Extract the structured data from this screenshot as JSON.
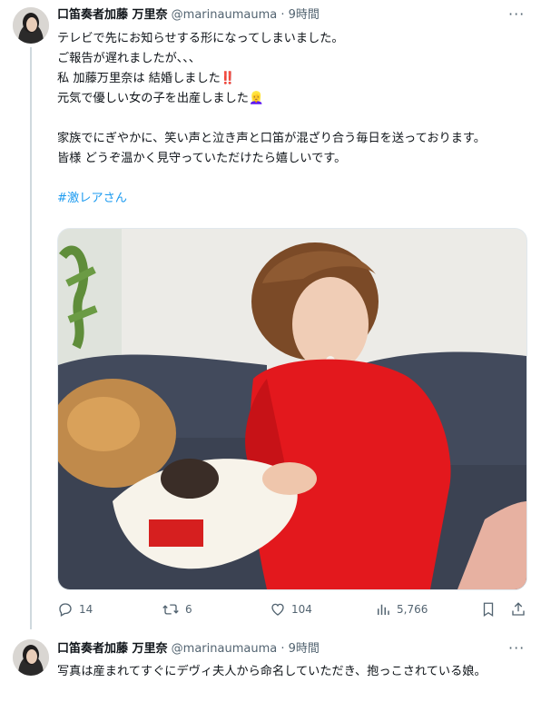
{
  "tweet1": {
    "display_name": "口笛奏者加藤 万里奈",
    "handle": "@marinaumauma",
    "separator": "·",
    "time": "9時間",
    "more": "···",
    "lines": [
      "テレビで先にお知らせする形になってしまいました。",
      "ご報告が遅れましたが、、、",
      "私 加藤万里奈は 結婚しました‼️",
      "元気で優しい女の子を出産しました👱‍♀️",
      "",
      "家族でにぎやかに、笑い声と泣き声と口笛が混ざり合う毎日を送っております。",
      "皆様 どうぞ温かく見守っていただけたら嬉しいです。",
      ""
    ],
    "hashtag": "#激レアさん",
    "media_alt": "赤いワンピースの女性がソファで赤ちゃんを抱いている写真",
    "actions": {
      "replies": "14",
      "retweets": "6",
      "likes": "104",
      "views": "5,766"
    }
  },
  "tweet2": {
    "display_name": "口笛奏者加藤 万里奈",
    "handle": "@marinaumauma",
    "separator": "·",
    "time": "9時間",
    "more": "···",
    "text": "写真は産まれてすぐにデヴィ夫人から命名していただき、抱っこされている娘。"
  },
  "colors": {
    "text": "#0f1419",
    "secondary": "#536471",
    "link": "#1d9bf0",
    "line": "#cfd9de"
  }
}
